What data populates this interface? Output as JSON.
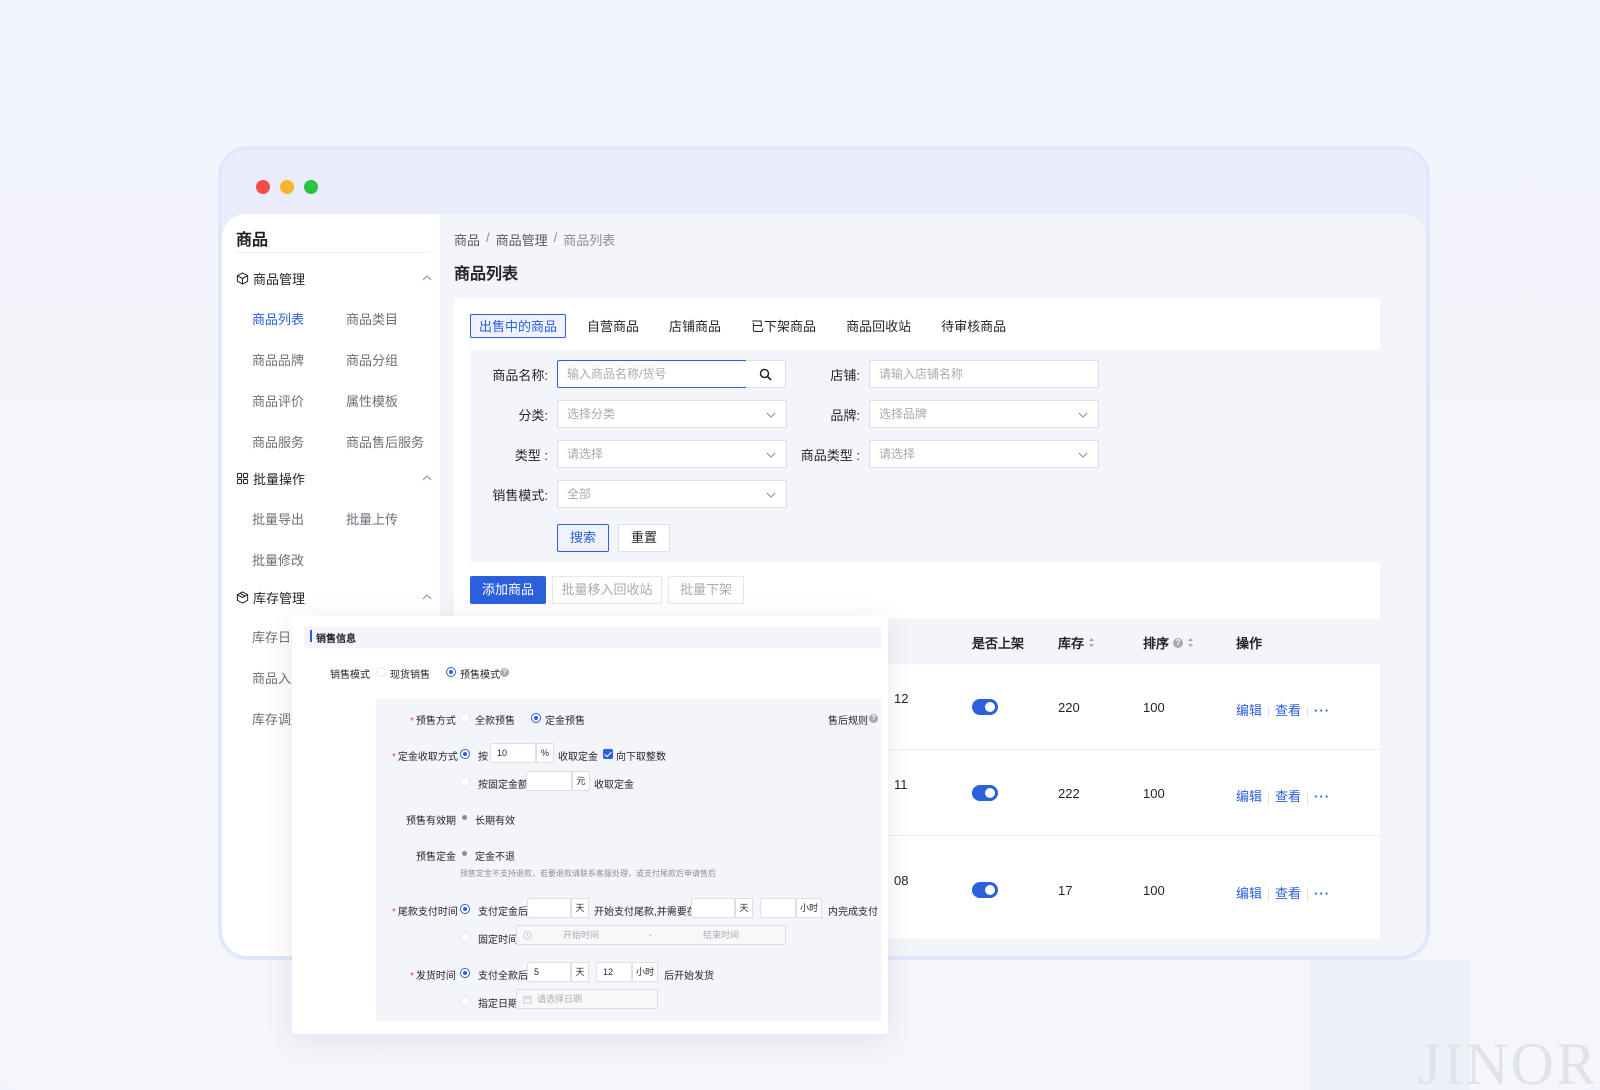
{
  "sidebar": {
    "title": "商品",
    "groups": [
      {
        "label": "商品管理",
        "items": [
          "商品列表",
          "商品类目",
          "商品品牌",
          "商品分组",
          "商品评价",
          "属性模板",
          "商品服务",
          "商品售后服务"
        ]
      },
      {
        "label": "批量操作",
        "items": [
          "批量导出",
          "批量上传",
          "批量修改"
        ]
      },
      {
        "label": "库存管理",
        "items": [
          "库存日志",
          "商品入库",
          "库存调整"
        ]
      }
    ]
  },
  "breadcrumb": [
    "商品",
    "商品管理",
    "商品列表"
  ],
  "page_title": "商品列表",
  "tabs": [
    "出售中的商品",
    "自营商品",
    "店铺商品",
    "已下架商品",
    "商品回收站",
    "待审核商品"
  ],
  "filters": {
    "name_label": "商品名称:",
    "name_placeholder": "输入商品名称/货号",
    "shop_label": "店铺:",
    "shop_placeholder": "请输入店铺名称",
    "category_label": "分类:",
    "category_placeholder": "选择分类",
    "brand_label": "品牌:",
    "brand_placeholder": "选择品牌",
    "type_label": "类型 :",
    "type_placeholder": "请选择",
    "goods_type_label": "商品类型 :",
    "goods_type_placeholder": "请选择",
    "sale_mode_label": "销售模式:",
    "sale_mode_value": "全部",
    "search_btn": "搜索",
    "reset_btn": "重置"
  },
  "actions": {
    "add": "添加商品",
    "move_recycle": "批量移入回收站",
    "batch_off": "批量下架"
  },
  "table": {
    "headers": {
      "on_shelf": "是否上架",
      "stock": "库存",
      "sort": "排序",
      "ops": "操作"
    },
    "rows": [
      {
        "id_tail": "12",
        "on_shelf": true,
        "stock": "220",
        "sort": "100"
      },
      {
        "id_tail": "11",
        "on_shelf": true,
        "stock": "222",
        "sort": "100"
      },
      {
        "id_tail": "08",
        "on_shelf": true,
        "stock": "17",
        "sort": "100"
      }
    ],
    "op_edit": "编辑",
    "op_view": "查看",
    "op_more": "···"
  },
  "sales_card": {
    "section_title": "销售信息",
    "mode_label": "销售模式",
    "mode_spot": "现货销售",
    "mode_presale": "预售模式",
    "presale_method_label": "预售方式",
    "method_full": "全款预售",
    "method_deposit": "定金预售",
    "after_sale_rule": "售后规则",
    "deposit_collect_label": "定金收取方式",
    "by": "按",
    "deposit_percent": "10",
    "percent_unit": "%",
    "collect_deposit": "收取定金",
    "round_down": "向下取整数",
    "fixed_amount": "按固定金额",
    "yuan": "元",
    "collect_deposit2": "收取定金",
    "validity_label": "预售有效期",
    "validity_value": "长期有效",
    "deposit_label": "预售定金",
    "deposit_value": "定金不退",
    "deposit_note": "预售定金不支持退款，若要退款请联系客服处理，或支付尾款后申请售后",
    "final_pay_label": "尾款支付时间",
    "after_deposit": "支付定金后",
    "day": "天",
    "start_final": "开始支付尾款,并需要在",
    "day2": "天",
    "hour": "小时",
    "finish_pay": "内完成支付",
    "fixed_time": "固定时间",
    "start_time": "开始时间",
    "dash": "-",
    "end_time": "结束时间",
    "ship_label": "发货时间",
    "after_full": "支付全款后",
    "ship_days": "5",
    "ship_day_unit": "天",
    "ship_hours": "12",
    "ship_hour_unit": "小时",
    "start_ship": "后开始发货",
    "specified_date": "指定日期",
    "date_placeholder": "请选择日期"
  },
  "watermark": "JINOR",
  "colors": {
    "accent": "#2b5fdc",
    "bg": "#f3f5fc"
  }
}
